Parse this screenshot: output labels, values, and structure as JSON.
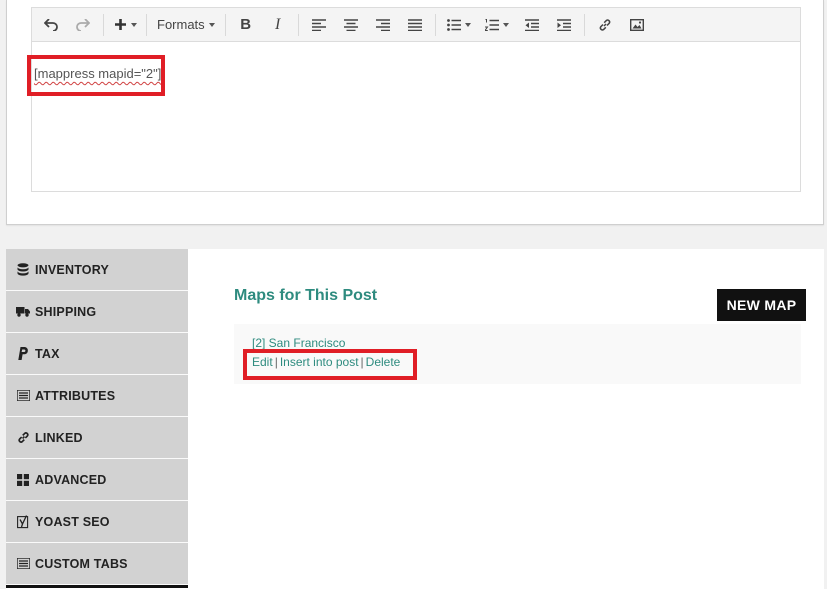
{
  "toolbar": {
    "formats_label": "Formats",
    "bold_label": "B",
    "italic_label": "I"
  },
  "editor": {
    "shortcode": "[mappress mapid=\"2\"]"
  },
  "tabs": [
    {
      "label": "INVENTORY",
      "icon": "database-icon"
    },
    {
      "label": "SHIPPING",
      "icon": "truck-icon"
    },
    {
      "label": "TAX",
      "icon": "paypal-icon"
    },
    {
      "label": "ATTRIBUTES",
      "icon": "list-icon"
    },
    {
      "label": "LINKED",
      "icon": "link-icon"
    },
    {
      "label": "ADVANCED",
      "icon": "grid-icon"
    },
    {
      "label": "YOAST SEO",
      "icon": "yoast-icon"
    },
    {
      "label": "CUSTOM TABS",
      "icon": "list-alt-icon"
    }
  ],
  "maps": {
    "title": "Maps for This Post",
    "new_map_label": "NEW MAP",
    "item_name": "[2] San Francisco",
    "edit_label": "Edit",
    "insert_label": "Insert into post",
    "delete_label": "Delete",
    "separator": "|"
  },
  "colors": {
    "accent_teal": "#2e8b7f",
    "highlight_red": "#e01e26",
    "button_dark": "#111111",
    "tab_gray": "#d2d2d2"
  }
}
